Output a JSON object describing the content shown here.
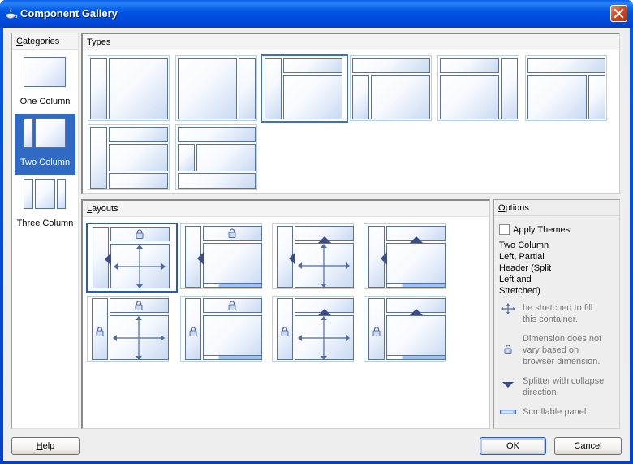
{
  "window": {
    "title": "Component Gallery",
    "icon": "java-cup-icon",
    "close_icon": "close-icon"
  },
  "categories": {
    "header": "Categories",
    "header_mnemonic": "C",
    "header_rest": "ategories",
    "items": [
      {
        "label": "One Column",
        "selected": false
      },
      {
        "label": "Two Column",
        "selected": true
      },
      {
        "label": "Three Column",
        "selected": false
      }
    ]
  },
  "types": {
    "header_mnemonic": "T",
    "header_rest": "ypes",
    "items": [
      {
        "name": "left-sidebar-main",
        "selected": false
      },
      {
        "name": "main-right-sidebar",
        "selected": false
      },
      {
        "name": "left-sidebar-header-main",
        "selected": true
      },
      {
        "name": "header-left-sidebar-main",
        "selected": false
      },
      {
        "name": "header-main-right-sidebar-full",
        "selected": false
      },
      {
        "name": "header-main-right-sidebar",
        "selected": false
      },
      {
        "name": "left-sidebar-header-main-footer",
        "selected": false
      },
      {
        "name": "header-left-main-footer",
        "selected": false
      }
    ]
  },
  "layouts": {
    "header_mnemonic": "L",
    "header_rest": "ayouts",
    "items": [
      {
        "name": "splitter-left-stretch",
        "selected": true
      },
      {
        "name": "splitter-left-scroll",
        "selected": false
      },
      {
        "name": "splitter-left-top-stretch",
        "selected": false
      },
      {
        "name": "splitter-left-top-scroll",
        "selected": false
      },
      {
        "name": "fixed-left-stretch",
        "selected": false
      },
      {
        "name": "fixed-left-scroll",
        "selected": false
      },
      {
        "name": "fixed-left-splitter-top-stretch",
        "selected": false
      },
      {
        "name": "fixed-left-splitter-top-scroll",
        "selected": false
      }
    ]
  },
  "options": {
    "header_mnemonic": "O",
    "header_rest": "ptions",
    "apply_themes_label": "Apply Themes",
    "apply_themes_checked": false,
    "description_lines": [
      "Two Column",
      "Left, Partial",
      "Header (Split",
      "Left and",
      "Stretched)"
    ],
    "legend": [
      {
        "icon": "stretch-arrows-icon",
        "lines": [
          "be stretched to fill",
          "this container."
        ]
      },
      {
        "icon": "lock-icon",
        "lines": [
          "Dimension does not",
          "vary based on",
          "browser dimension."
        ]
      },
      {
        "icon": "splitter-arrow-icon",
        "lines": [
          "Splitter with collapse",
          "direction."
        ]
      },
      {
        "icon": "scrollbar-icon",
        "lines": [
          "Scrollable panel."
        ]
      }
    ]
  },
  "buttons": {
    "help_mnemonic": "H",
    "help_rest": "elp",
    "ok": "OK",
    "cancel": "Cancel"
  },
  "colors": {
    "titlebar": "#0055e5",
    "selection": "#316ac5",
    "thumb_border": "#5a6ea8",
    "thumb_frame": "#b9cfe8",
    "close": "#d2451f"
  }
}
